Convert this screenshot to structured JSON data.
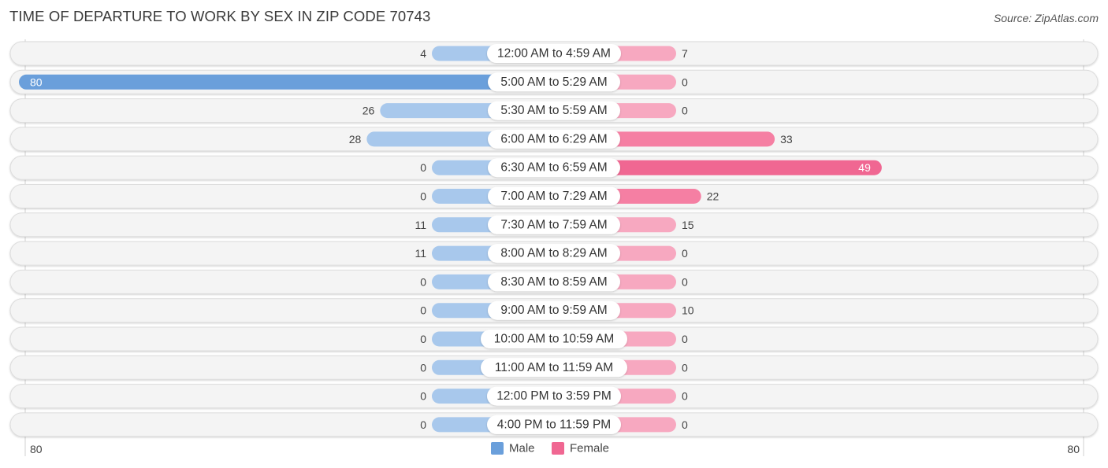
{
  "header": {
    "title": "TIME OF DEPARTURE TO WORK BY SEX IN ZIP CODE 70743",
    "source": "Source: ZipAtlas.com"
  },
  "colors": {
    "male": "#6a9fdb",
    "male_light": "#a8c8ec",
    "female": "#f06792",
    "female_light": "#f7a8c0",
    "row_background": "#f4f4f4"
  },
  "chart_data": {
    "type": "bar",
    "orientation": "horizontal-diverging",
    "title": "TIME OF DEPARTURE TO WORK BY SEX IN ZIP CODE 70743",
    "categories": [
      "12:00 AM to 4:59 AM",
      "5:00 AM to 5:29 AM",
      "5:30 AM to 5:59 AM",
      "6:00 AM to 6:29 AM",
      "6:30 AM to 6:59 AM",
      "7:00 AM to 7:29 AM",
      "7:30 AM to 7:59 AM",
      "8:00 AM to 8:29 AM",
      "8:30 AM to 8:59 AM",
      "9:00 AM to 9:59 AM",
      "10:00 AM to 10:59 AM",
      "11:00 AM to 11:59 AM",
      "12:00 PM to 3:59 PM",
      "4:00 PM to 11:59 PM"
    ],
    "series": [
      {
        "name": "Male",
        "values": [
          4,
          80,
          26,
          28,
          0,
          0,
          11,
          11,
          0,
          0,
          0,
          0,
          0,
          0
        ]
      },
      {
        "name": "Female",
        "values": [
          7,
          0,
          0,
          33,
          49,
          22,
          15,
          0,
          0,
          10,
          0,
          0,
          0,
          0
        ]
      }
    ],
    "axis": {
      "left_max": 80,
      "right_max": 80,
      "left_label": "80",
      "right_label": "80"
    },
    "legend": {
      "position": "bottom-center",
      "entries": [
        "Male",
        "Female"
      ]
    },
    "xlabel": "",
    "ylabel": "",
    "grid": false
  }
}
